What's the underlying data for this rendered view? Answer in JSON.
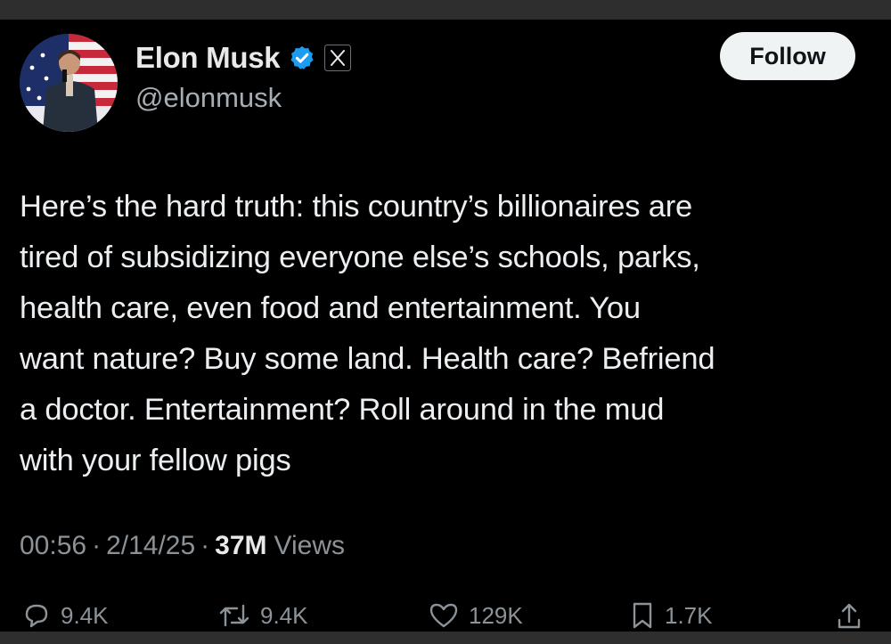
{
  "author": {
    "display_name": "Elon Musk",
    "handle": "@elonmusk",
    "verified": true,
    "affiliation_icon": "x-logo-icon"
  },
  "follow_button": {
    "label": "Follow"
  },
  "tweet": {
    "text": "Here’s the hard truth: this country’s billionaires are\ntired of subsidizing everyone else’s schools, parks,\nhealth care, even food and entertainment. You\nwant nature? Buy some land. Health care? Befriend\na doctor. Entertainment? Roll around in the mud\nwith your fellow pigs",
    "time": "00:56",
    "date": "2/14/25",
    "separator": "·",
    "views_count": "37M",
    "views_label": "Views"
  },
  "actions": {
    "replies": "9.4K",
    "reposts": "9.4K",
    "likes": "129K",
    "bookmarks": "1.7K"
  },
  "colors": {
    "background": "#000000",
    "text": "#e7e9ea",
    "secondary_text": "#8b9298",
    "verified_blue": "#1d9bf0",
    "follow_button_bg": "#eff3f4"
  }
}
